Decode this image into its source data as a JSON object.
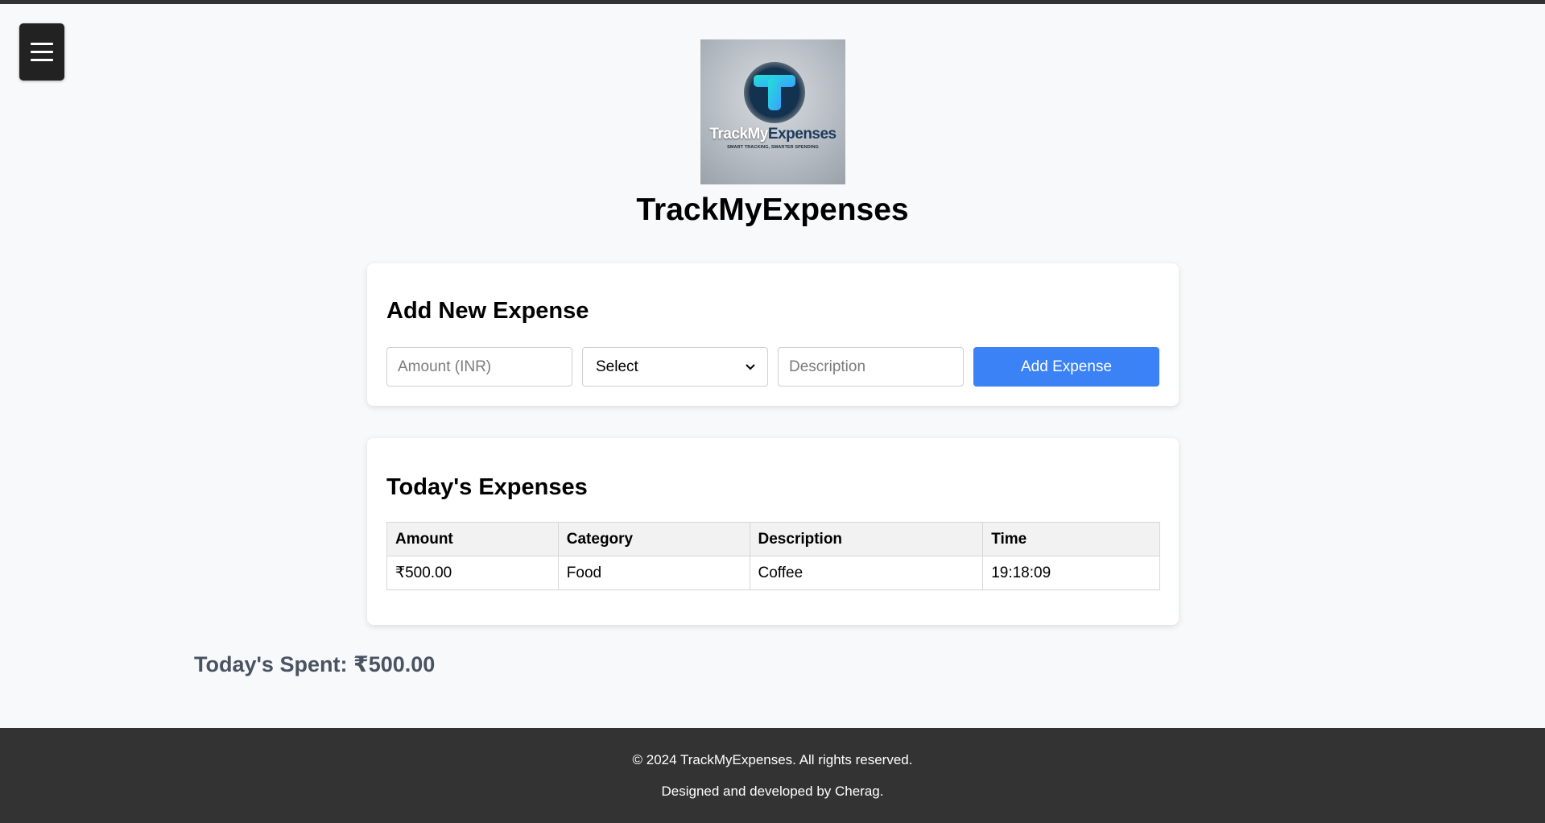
{
  "menu": {
    "icon": "hamburger-menu-icon"
  },
  "logo": {
    "brand_part1": "TrackMy",
    "brand_part2": "Expenses",
    "tagline": "SMART TRACKING, SMARTER SPENDING"
  },
  "header": {
    "title": "TrackMyExpenses"
  },
  "add_expense": {
    "heading": "Add New Expense",
    "amount_placeholder": "Amount (INR)",
    "category_selected": "Select",
    "description_placeholder": "Description",
    "submit_label": "Add Expense"
  },
  "todays_expenses": {
    "heading": "Today's Expenses",
    "columns": [
      "Amount",
      "Category",
      "Description",
      "Time"
    ],
    "rows": [
      {
        "amount": "₹500.00",
        "category": "Food",
        "description": "Coffee",
        "time": "19:18:09"
      }
    ]
  },
  "summary": {
    "total_text": "Today's Spent: ₹500.00"
  },
  "footer": {
    "copyright": "© 2024 TrackMyExpenses. All rights reserved.",
    "credit": "Designed and developed by Cherag."
  },
  "colors": {
    "accent": "#3b82f6",
    "dark": "#333333",
    "background": "#f8f9fb",
    "total_text": "#4a5362"
  }
}
